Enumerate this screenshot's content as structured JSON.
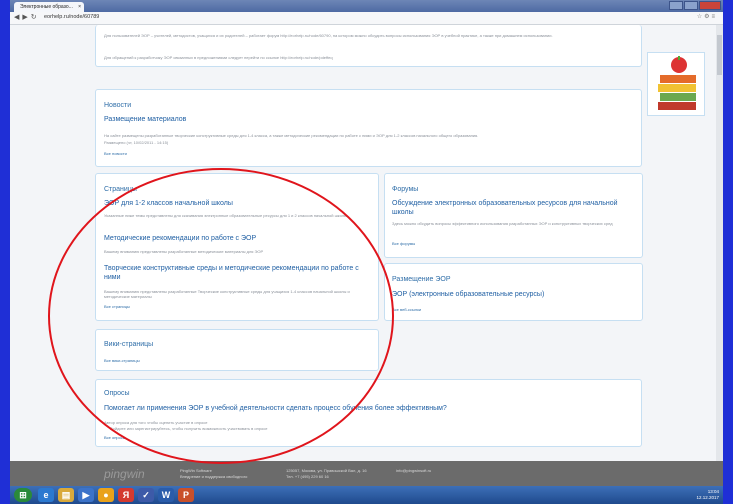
{
  "browser": {
    "tab_title": "Электронные образо...",
    "url": "eorhelp.ru/node/60789"
  },
  "intro": {
    "text1": "Для пользователей ЭОР – учителей, методистов, учащихся и их родителей – работает форум http://eorhelp.ru/node/60790, на котором можно обсудить вопросы использования ЭОР в учебной практике, а также при домашнем использовании.",
    "text2": "Для обращений к разработчику ЭОР связанных в предложениями следует перейти по ссылке http://eorhelp.ru/node/pdeffeq"
  },
  "news": {
    "header": "Новости",
    "item_title": "Размещение материалов",
    "item_text": "На сайте размещены разработанные творческие конструктивные среды для 1-4 класса, а также методические рекомендации по работе с ними и ЭОР для 1-2 классов начального общего образования.",
    "item_date": "Размещено (чт, 10/02/2011 - 14:15)",
    "more": "Все новости"
  },
  "pages": {
    "header": "Страницы",
    "items": [
      {
        "title": "ЭОР для 1-2 классов начальной школы",
        "desc": "Указанные ниже темы представлены для скачивания электронные образовательные ресурсы для 1 и 2 классов начальной школы"
      },
      {
        "title": "Методические рекомендации по работе с ЭОР",
        "desc": "Вашему вниманию представлены разработанные методические материалы для ЭОР"
      },
      {
        "title": "Творческие конструктивные среды и методические рекомендации по работе с ними",
        "desc": "Вашему вниманию представлены разработанные Творческие конструктивные среды для учащихся 1-4 классов начальной школы и методические материалы"
      }
    ],
    "more": "Все страницы"
  },
  "forums": {
    "header": "Форумы",
    "item_title": "Обсуждение электронных образовательных ресурсов для начальной школы",
    "item_desc": "Здесь можно обсудить вопросы эффективного использования разработанных ЭОР и конструктивных творческих сред",
    "more": "Все форумы"
  },
  "placement": {
    "header": "Размещение ЭОР",
    "item_title": "ЭОР (электронные образовательные ресурсы)",
    "more": "Все веб-ссылки"
  },
  "wiki": {
    "header": "Вики-страницы",
    "more": "Все вики-страницы"
  },
  "polls": {
    "header": "Опросы",
    "question": "Помогает ли применения ЭОР в учебной деятельности сделать процесс обучения более эффективным?",
    "answer_hint": "Автор опроса для того чтобы оценить участие в опросе",
    "option": "Войдите или зарегистрируйтесь, чтобы получить возможность участвовать в опросе",
    "more": "Все опросы"
  },
  "footer": {
    "logo": "pingwin",
    "company": "PingWin Software",
    "company_sub": "Внедрение и поддержка свободного",
    "address": "125057, Москва, ул. Правошской Вал, д. 16",
    "phone": "Тел. +7 (495) 229 60 16",
    "email": "info@pingwinsoft.ru"
  },
  "taskbar": {
    "time": "13:04",
    "date": "12.12.2017"
  },
  "colors": {
    "accent": "#2f6ea8",
    "annotation": "#e0151c",
    "background": "#1f2fd6"
  }
}
